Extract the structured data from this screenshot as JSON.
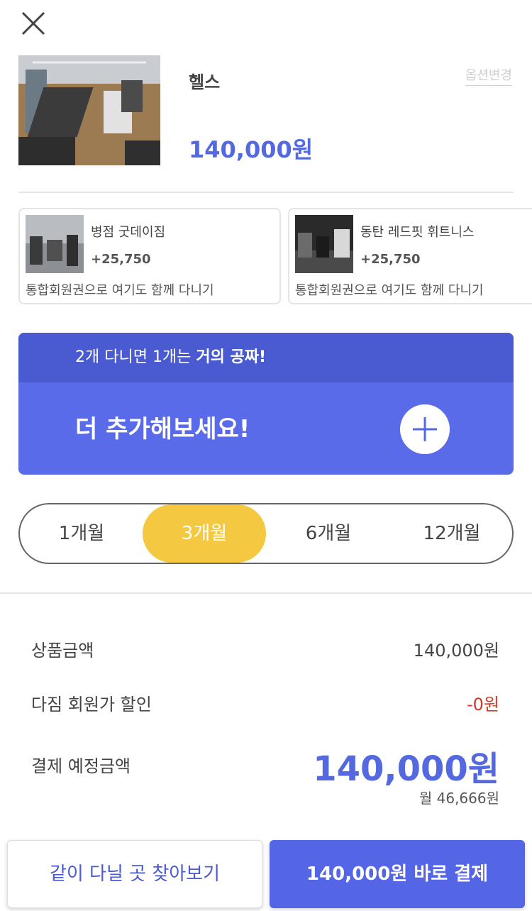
{
  "colors": {
    "accent": "#5468e0",
    "promo_top": "#4a5bd2",
    "promo_bg": "#5a6bea",
    "selected_period": "#f5c842",
    "discount_red": "#d23a2a"
  },
  "header": {
    "close_icon": "close-icon"
  },
  "product": {
    "name": "헬스",
    "option_change": "옵션변경",
    "price": "140,000원"
  },
  "gyms": [
    {
      "name": "병점 굿데이짐",
      "price": "+25,750",
      "desc": "통합회원권으로 여기도 함께 다니기"
    },
    {
      "name": "동탄 레드핏 휘트니스",
      "price": "+25,750",
      "desc": "통합회원권으로 여기도 함께 다니기"
    }
  ],
  "promo": {
    "top_prefix": "2개 다니면 1개는 ",
    "top_bold": "거의 공짜!",
    "main": "더 추가해보세요!",
    "add_icon": "plus-icon"
  },
  "periods": [
    "1개월",
    "3개월",
    "6개월",
    "12개월"
  ],
  "selected_period": "3개월",
  "summary": {
    "product_amount_label": "상품금액",
    "product_amount_value": "140,000원",
    "discount_label": "다짐 회원가 할인",
    "discount_value": "-0원",
    "total_label": "결제 예정금액",
    "total_value": "140,000원",
    "monthly": "월 46,666원"
  },
  "footer": {
    "find_label": "같이 다닐 곳 찾아보기",
    "pay_label": "140,000원 바로 결제"
  }
}
